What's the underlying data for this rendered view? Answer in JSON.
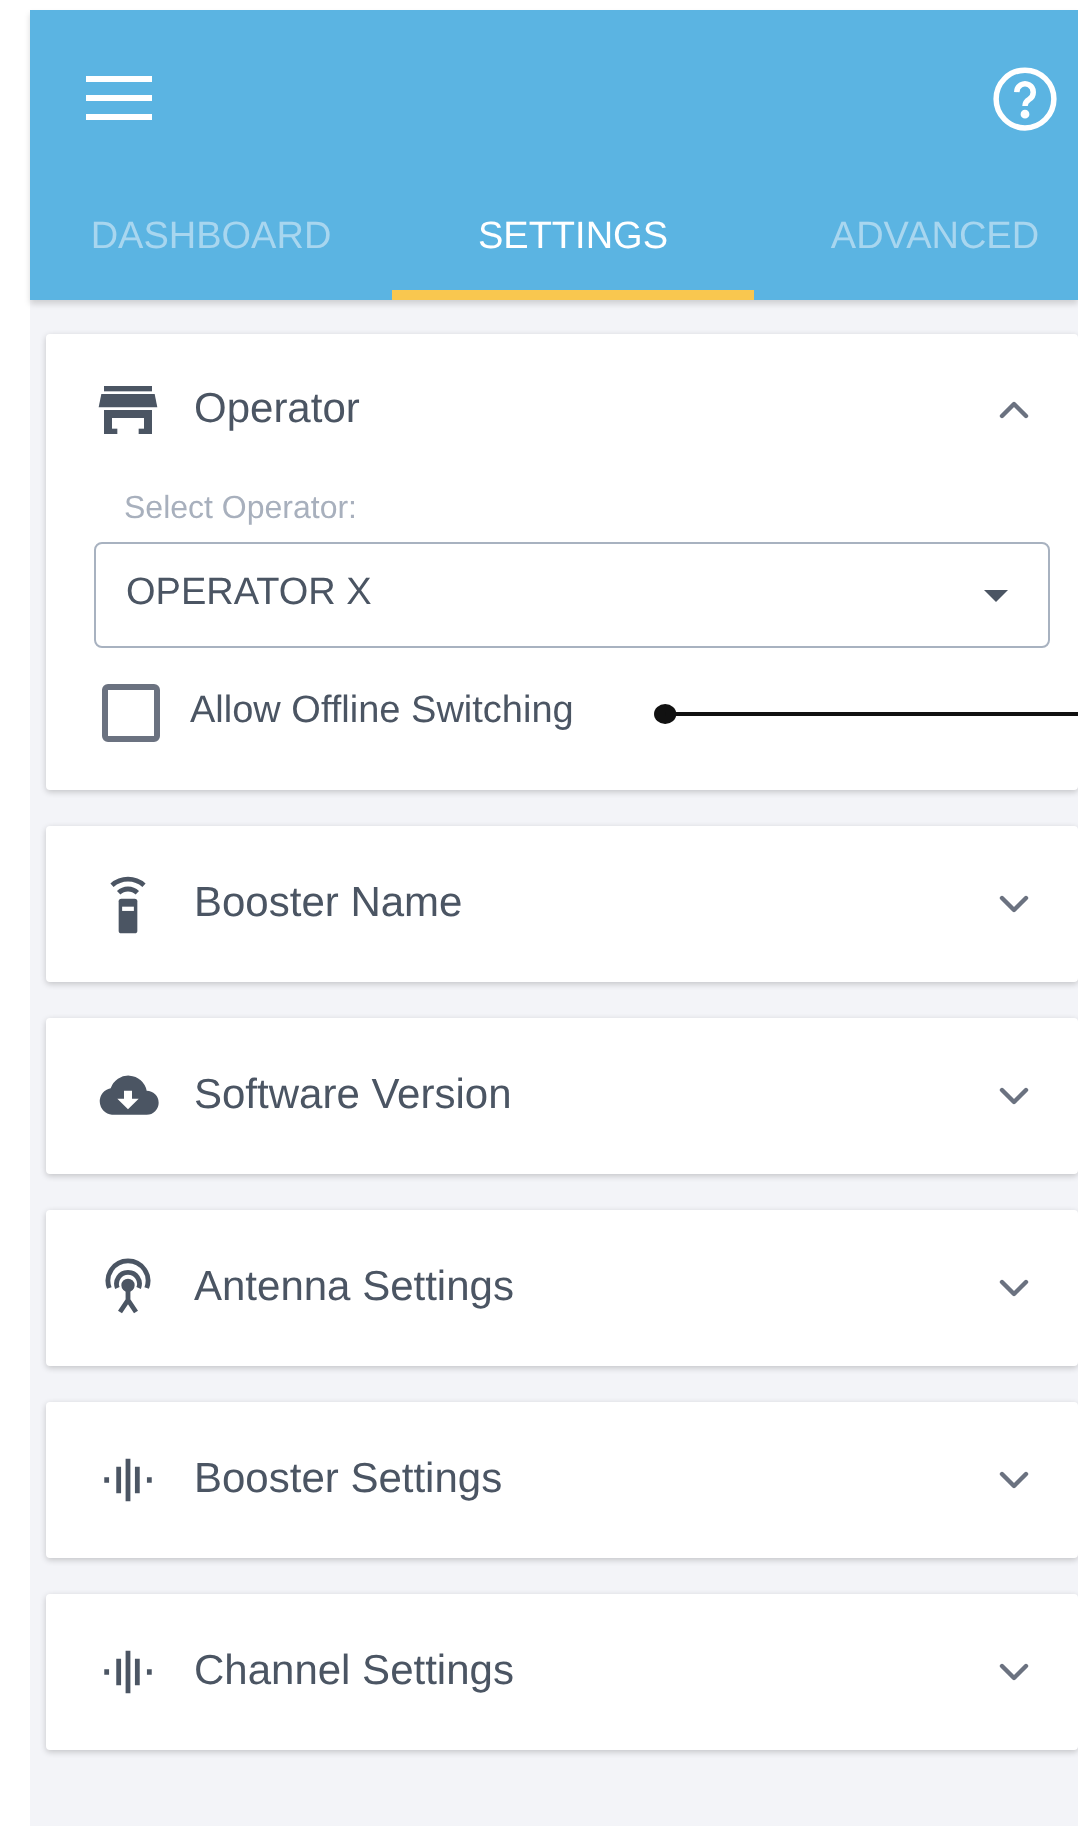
{
  "tabs": [
    {
      "label": "DASHBOARD",
      "selected": false
    },
    {
      "label": "SETTINGS",
      "selected": true
    },
    {
      "label": "ADVANCED",
      "selected": false
    }
  ],
  "sections": [
    {
      "kind": "store",
      "title": "Operator",
      "expanded": true,
      "field_label": "Select Operator:",
      "select_value": "OPERATOR X",
      "checkbox": {
        "label": "Allow Offline Switching",
        "checked": false
      }
    },
    {
      "kind": "remote",
      "title": "Booster Name",
      "expanded": false
    },
    {
      "kind": "cloud",
      "title": "Software Version",
      "expanded": false
    },
    {
      "kind": "antenna",
      "title": "Antenna Settings",
      "expanded": false
    },
    {
      "kind": "wave",
      "title": "Booster Settings",
      "expanded": false
    },
    {
      "kind": "wave",
      "title": "Channel Settings",
      "expanded": false
    }
  ]
}
